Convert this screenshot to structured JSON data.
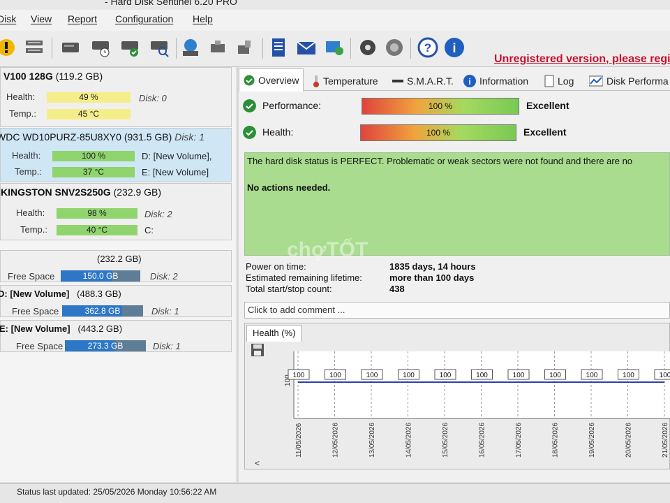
{
  "window": {
    "title": "- Hard Disk Sentinel 6.20 PRO"
  },
  "menu": {
    "items": [
      "Disk",
      "View",
      "Report",
      "Configuration",
      "Help"
    ]
  },
  "toolbar": {
    "unregistered": "Unregistered version, please regi"
  },
  "disks": [
    {
      "name": "V100 128G",
      "size": "(119.2 GB)",
      "health_label": "Health:",
      "health": "49 %",
      "health_pct": 49,
      "temp_label": "Temp.:",
      "temp": "45 °C",
      "disk_info": "Disk: 0",
      "vol_info": "",
      "color": "#f4ee8a",
      "selected": false
    },
    {
      "name": "WDC WD10PURZ-85U8XY0",
      "size": "(931.5 GB)",
      "disk_info": "Disk: 1",
      "health_label": "Health:",
      "health": "100 %",
      "health_pct": 100,
      "temp_label": "Temp.:",
      "temp": "37 °C",
      "vol1": "D: [New Volume],",
      "vol2": "E: [New Volume]",
      "color": "#8fd46d",
      "selected": true
    },
    {
      "name": "KINGSTON SNV2S250G",
      "size": "(232.9 GB)",
      "health_label": "Health:",
      "health": "98 %",
      "health_pct": 98,
      "temp_label": "Temp.:",
      "temp": "40 °C",
      "disk_info": "Disk: 2",
      "vol_info": "C:",
      "color": "#8fd46d",
      "selected": false
    }
  ],
  "volumes": [
    {
      "name": "",
      "size": "(232.2 GB)",
      "free_label": "Free Space",
      "free": "150.0 GB",
      "free_pct": 65,
      "disk": "Disk: 2"
    },
    {
      "name": "D: [New Volume]",
      "size": "(488.3 GB)",
      "free_label": "Free Space",
      "free": "362.8 GB",
      "free_pct": 74,
      "disk": "Disk: 1"
    },
    {
      "name": "E: [New Volume]",
      "size": "(443.2 GB)",
      "free_label": "Free Space",
      "free": "273.3 GB",
      "free_pct": 62,
      "disk": "Disk: 1"
    }
  ],
  "tabs": [
    "Overview",
    "Temperature",
    "S.M.A.R.T.",
    "Information",
    "Log",
    "Disk Performa"
  ],
  "overview": {
    "performance_label": "Performance:",
    "performance": "100 %",
    "performance_rating": "Excellent",
    "health_label": "Health:",
    "health": "100 %",
    "health_rating": "Excellent",
    "status_text": "The hard disk status is PERFECT. Problematic or weak sectors were not found and there are no",
    "actions_text": "No actions needed.",
    "power_on_label": "Power on time:",
    "power_on": "1835 days, 14 hours",
    "lifetime_label": "Estimated remaining lifetime:",
    "lifetime": "more than 100 days",
    "startstop_label": "Total start/stop count:",
    "startstop": "438",
    "comment_placeholder": "Click to add comment ..."
  },
  "chart_tab": "Health (%)",
  "chart_data": {
    "type": "line",
    "ylabel": "100",
    "x": [
      "11/05/2026",
      "12/05/2026",
      "13/05/2026",
      "14/05/2026",
      "15/05/2026",
      "16/05/2026",
      "17/05/2026",
      "18/05/2026",
      "19/05/2026",
      "20/05/2026",
      "21/05/2026"
    ],
    "series": [
      {
        "values": [
          100,
          100,
          100,
          100,
          100,
          100,
          100,
          100,
          100,
          100,
          100
        ]
      }
    ],
    "data_labels": [
      "100",
      "100",
      "100",
      "100",
      "100",
      "100",
      "100",
      "100",
      "100",
      "100",
      "100"
    ],
    "line_color": "#2b3fb5"
  },
  "statusbar": {
    "text": "Status last updated: 25/05/2026 Monday 10:56:22 AM"
  },
  "watermark": "chợTỐT"
}
